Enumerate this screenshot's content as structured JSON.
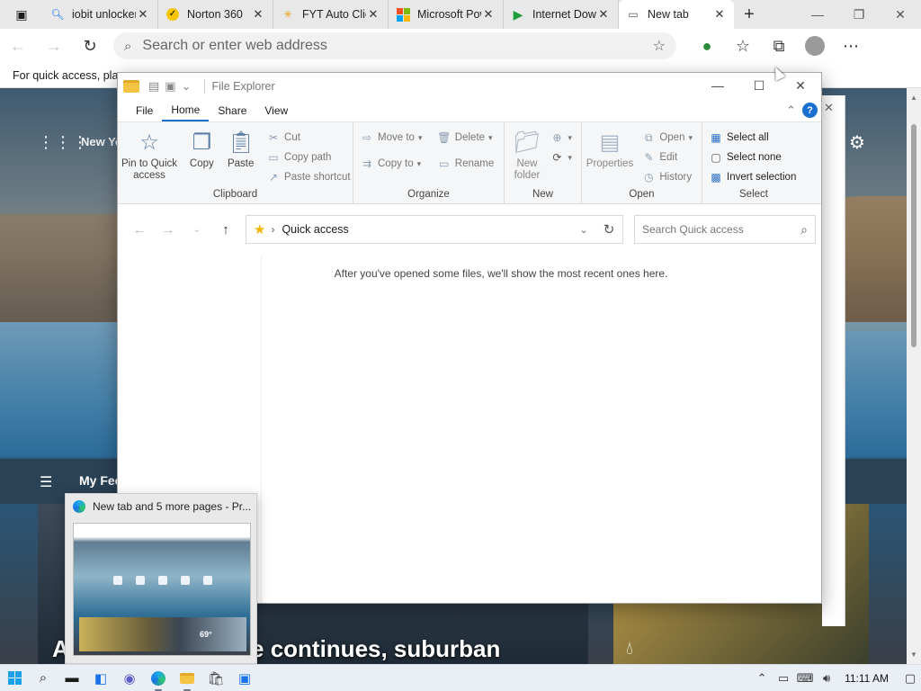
{
  "browser": {
    "tabs": [
      {
        "title": "iobit unlocker",
        "icon": "search-icon",
        "icon_color": "#1a73e8"
      },
      {
        "title": "Norton 360",
        "icon": "norton-icon",
        "icon_color": "#f7c600"
      },
      {
        "title": "FYT Auto Clicker",
        "icon": "fyt-icon",
        "icon_color": "#e8a21a"
      },
      {
        "title": "Microsoft Power",
        "icon": "microsoft-icon",
        "icon_color": "#f25022"
      },
      {
        "title": "Internet Download",
        "icon": "idm-icon",
        "icon_color": "#1e9e3a"
      },
      {
        "title": "New tab",
        "icon": "new-tab-icon",
        "icon_color": "#555555"
      }
    ],
    "address_placeholder": "Search or enter web address",
    "favorites_bar_text": "For quick access, plac"
  },
  "ntp": {
    "city": "New Yo",
    "feed_title": "My Fee",
    "headline": "As abortion debate continues, suburban"
  },
  "explorer": {
    "title": "File Explorer",
    "ribbon_tabs": [
      "File",
      "Home",
      "Share",
      "View"
    ],
    "clipboard": {
      "pin": "Pin to Quick access",
      "copy": "Copy",
      "paste": "Paste",
      "cut": "Cut",
      "copy_path": "Copy path",
      "paste_shortcut": "Paste shortcut",
      "label": "Clipboard"
    },
    "organize": {
      "move_to": "Move to",
      "copy_to": "Copy to",
      "delete": "Delete",
      "rename": "Rename",
      "label": "Organize"
    },
    "new": {
      "new_folder": "New folder",
      "label": "New"
    },
    "open": {
      "properties": "Properties",
      "open": "Open",
      "edit": "Edit",
      "history": "History",
      "label": "Open"
    },
    "select": {
      "select_all": "Select all",
      "select_none": "Select none",
      "invert": "Invert selection",
      "label": "Select"
    },
    "location": "Quick access",
    "search_placeholder": "Search Quick access",
    "empty_message": "After you've opened some files, we'll show the most recent ones here."
  },
  "preview": {
    "title": "New tab and 5 more pages - Pr...",
    "temperature": "69°"
  },
  "taskbar": {
    "clock": "11:11 AM"
  },
  "colors": {
    "accent": "#1a6fd1",
    "taskbar_bg": "#eaeff5"
  }
}
